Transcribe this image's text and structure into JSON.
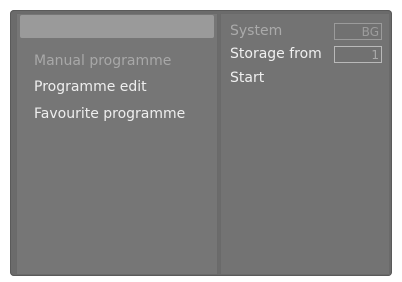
{
  "left_menu": {
    "items": [
      {
        "label": ""
      },
      {
        "label": "Manual programme"
      },
      {
        "label": "Programme edit"
      },
      {
        "label": "Favourite programme"
      }
    ]
  },
  "right_panel": {
    "rows": [
      {
        "label": "System",
        "value": "BG"
      },
      {
        "label": "Storage from",
        "value": "1"
      },
      {
        "label": "Start"
      }
    ]
  },
  "colors": {
    "screen_bg": "#6b6b6b",
    "selection_bar": "#9a9a9a",
    "text_dim": "#a8a8a8",
    "text_bright": "#eeeeee"
  }
}
